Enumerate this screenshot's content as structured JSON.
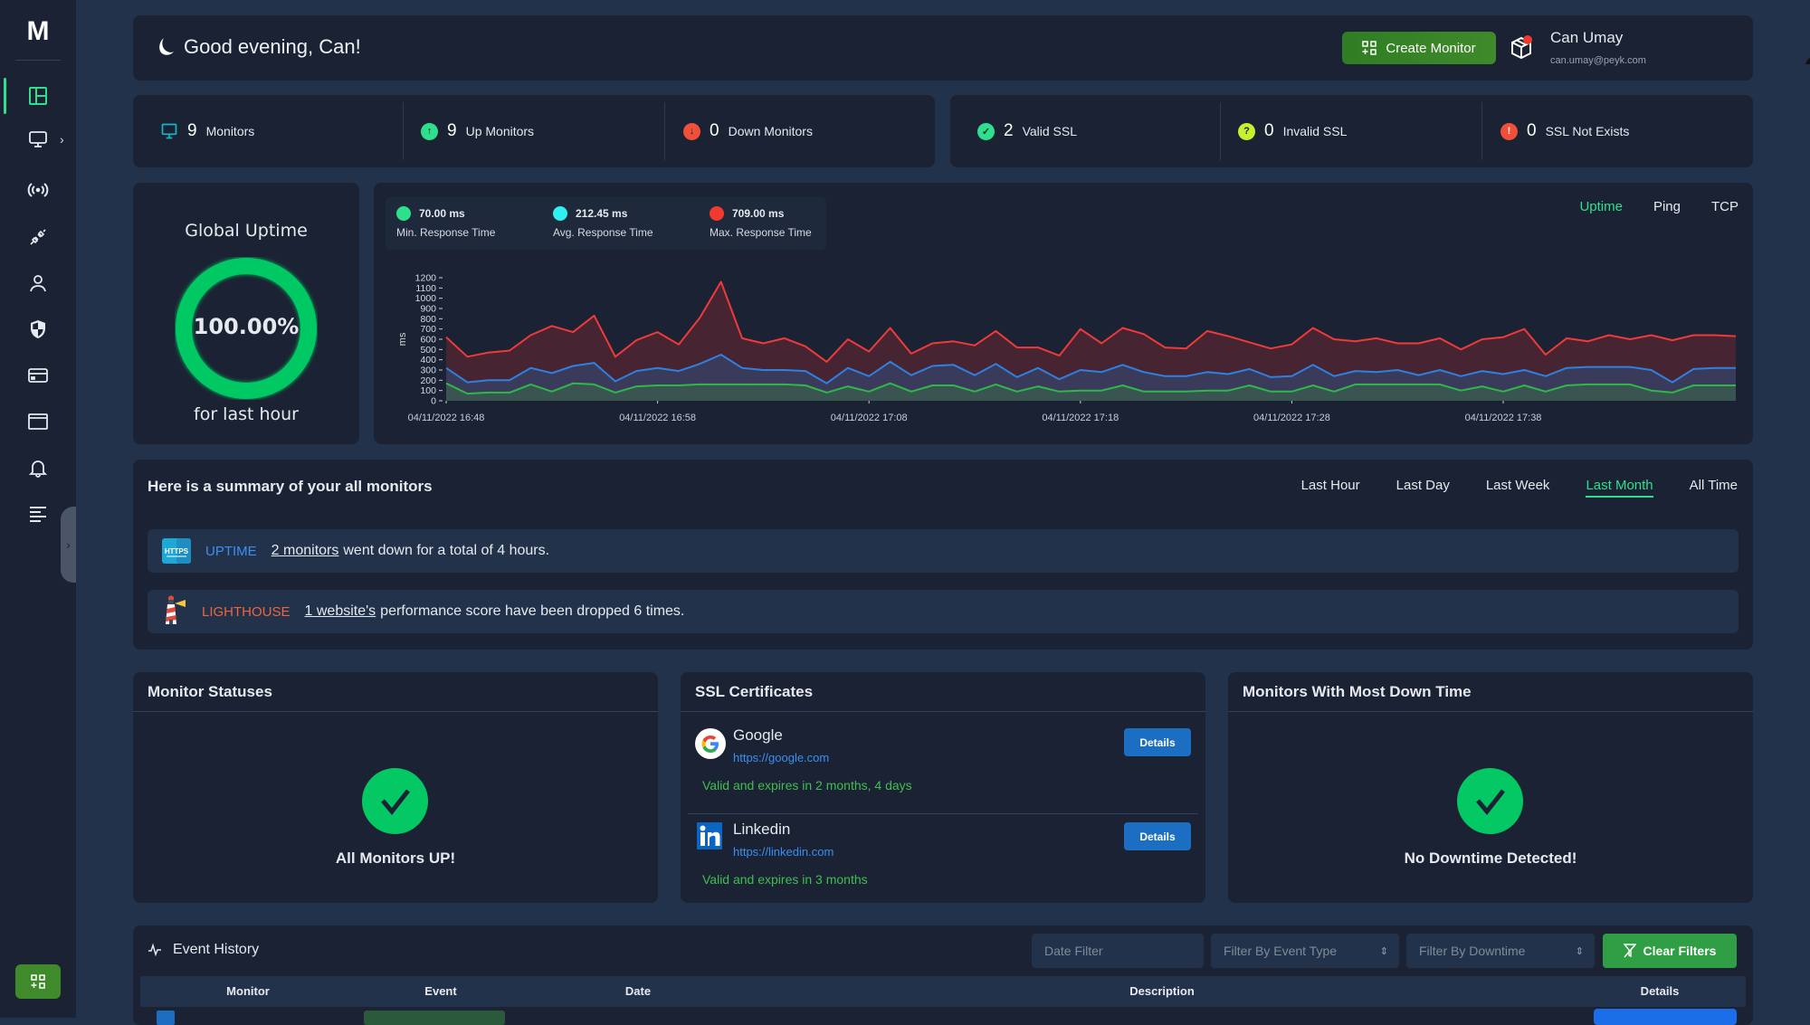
{
  "sidebar": {
    "logo": "M",
    "items": [
      {
        "icon": "dashboard-icon",
        "active": true
      },
      {
        "icon": "monitor-icon",
        "has_submenu": true
      },
      {
        "icon": "broadcast-icon"
      },
      {
        "icon": "plug-icon"
      },
      {
        "icon": "user-icon"
      },
      {
        "icon": "shield-icon"
      },
      {
        "icon": "credit-card-icon"
      },
      {
        "icon": "browser-window-icon"
      },
      {
        "icon": "bell-icon"
      },
      {
        "icon": "text-lines-icon"
      }
    ],
    "accent": "#2ee08c"
  },
  "header": {
    "greeting": "Good evening, Can!",
    "create_monitor_label": "Create Monitor",
    "user_name": "Can Umay",
    "user_email": "can.umay@peyk.com"
  },
  "stats": {
    "monitors": {
      "count": "9",
      "label": "Monitors"
    },
    "up": {
      "count": "9",
      "label": "Up Monitors"
    },
    "down": {
      "count": "0",
      "label": "Down Monitors"
    },
    "valid_ssl": {
      "count": "2",
      "label": "Valid SSL"
    },
    "invalid_ssl": {
      "count": "0",
      "label": "Invalid SSL"
    },
    "ssl_not_exists": {
      "count": "0",
      "label": "SSL Not Exists"
    }
  },
  "uptime": {
    "title": "Global Uptime",
    "value": "100.00%",
    "percent": 100,
    "subtitle": "for last hour",
    "color": "#04c864"
  },
  "response_legend": {
    "min": {
      "value": "70.00 ms",
      "label": "Min. Response Time",
      "color": "#2ee08c"
    },
    "avg": {
      "value": "212.45 ms",
      "label": "Avg. Response Time",
      "color": "#2ef0f0"
    },
    "max": {
      "value": "709.00 ms",
      "label": "Max. Response Time",
      "color": "#f03a2e"
    }
  },
  "chart_tabs": [
    {
      "label": "Uptime",
      "active": true
    },
    {
      "label": "Ping",
      "active": false
    },
    {
      "label": "TCP",
      "active": false
    }
  ],
  "chart_data": {
    "type": "area",
    "title": "",
    "xlabel": "",
    "ylabel": "ms",
    "ylim": [
      0,
      1200
    ],
    "yticks": [
      0,
      100,
      200,
      300,
      400,
      500,
      600,
      700,
      800,
      900,
      1000,
      1100,
      1200
    ],
    "x_tick_labels": [
      "04/11/2022 16:48",
      "04/11/2022 16:58",
      "04/11/2022 17:08",
      "04/11/2022 17:18",
      "04/11/2022 17:28",
      "04/11/2022 17:38"
    ],
    "x_start_minute": 0,
    "x_tick_minutes": [
      0,
      10,
      20,
      30,
      40,
      50
    ],
    "grid": false,
    "series": [
      {
        "name": "Max",
        "color": "#f03a3a",
        "values": [
          620,
          430,
          470,
          490,
          640,
          730,
          670,
          830,
          430,
          590,
          670,
          550,
          810,
          1160,
          610,
          560,
          610,
          530,
          380,
          600,
          480,
          710,
          460,
          560,
          580,
          540,
          680,
          520,
          520,
          440,
          700,
          560,
          710,
          650,
          520,
          510,
          680,
          630,
          570,
          510,
          550,
          710,
          600,
          580,
          610,
          560,
          560,
          610,
          500,
          600,
          620,
          700,
          450,
          610,
          580,
          640,
          600,
          640,
          590,
          640,
          640,
          630
        ]
      },
      {
        "name": "Avg",
        "color": "#2f80e0",
        "values": [
          320,
          180,
          200,
          200,
          320,
          270,
          340,
          370,
          190,
          290,
          320,
          290,
          360,
          450,
          320,
          300,
          300,
          290,
          170,
          320,
          240,
          380,
          250,
          340,
          350,
          250,
          360,
          230,
          320,
          210,
          300,
          280,
          350,
          280,
          240,
          240,
          280,
          260,
          310,
          230,
          240,
          350,
          240,
          290,
          280,
          300,
          250,
          300,
          240,
          290,
          260,
          300,
          240,
          320,
          330,
          330,
          330,
          300,
          180,
          310,
          320,
          320
        ]
      },
      {
        "name": "Min",
        "color": "#2fb84a",
        "values": [
          170,
          70,
          80,
          80,
          160,
          90,
          170,
          160,
          80,
          140,
          150,
          150,
          160,
          160,
          160,
          160,
          160,
          150,
          80,
          140,
          90,
          170,
          90,
          150,
          150,
          90,
          160,
          90,
          140,
          90,
          100,
          100,
          150,
          90,
          90,
          90,
          100,
          100,
          150,
          90,
          90,
          150,
          90,
          160,
          160,
          160,
          160,
          160,
          100,
          140,
          90,
          150,
          90,
          150,
          160,
          160,
          160,
          100,
          80,
          150,
          150,
          150
        ]
      }
    ]
  },
  "summary": {
    "title": "Here is a summary of your all monitors",
    "ranges": [
      {
        "label": "Last Hour",
        "active": false
      },
      {
        "label": "Last Day",
        "active": false
      },
      {
        "label": "Last Week",
        "active": false
      },
      {
        "label": "Last Month",
        "active": true
      },
      {
        "label": "All Time",
        "active": false
      }
    ],
    "alerts": [
      {
        "icon": "https-icon",
        "tag": "UPTIME",
        "tag_color": "#3c8ff0",
        "link": "2 monitors",
        "text": "went down for a total of 4 hours."
      },
      {
        "icon": "lighthouse-icon",
        "tag": "LIGHTHOUSE",
        "tag_color": "#f0643c",
        "link": "1 website's",
        "text": "performance score have been dropped 6 times."
      }
    ]
  },
  "monitor_statuses": {
    "title": "Monitor Statuses",
    "message": "All Monitors UP!"
  },
  "ssl_certificates": {
    "title": "SSL Certificates",
    "items": [
      {
        "name": "Google",
        "url": "https://google.com",
        "status": "Valid and expires in 2 months, 4 days",
        "button": "Details",
        "icon": "google-icon"
      },
      {
        "name": "Linkedin",
        "url": "https://linkedin.com",
        "status": "Valid and expires in 3 months",
        "button": "Details",
        "icon": "linkedin-icon"
      }
    ]
  },
  "most_downtime": {
    "title": "Monitors With Most Down Time",
    "message": "No Downtime Detected!"
  },
  "event_history": {
    "title": "Event History",
    "date_filter_placeholder": "Date Filter",
    "event_type_placeholder": "Filter By Event Type",
    "downtime_placeholder": "Filter By Downtime",
    "clear_filters": "Clear Filters",
    "columns": [
      "Monitor",
      "Event",
      "Date",
      "Description",
      "Details"
    ]
  }
}
